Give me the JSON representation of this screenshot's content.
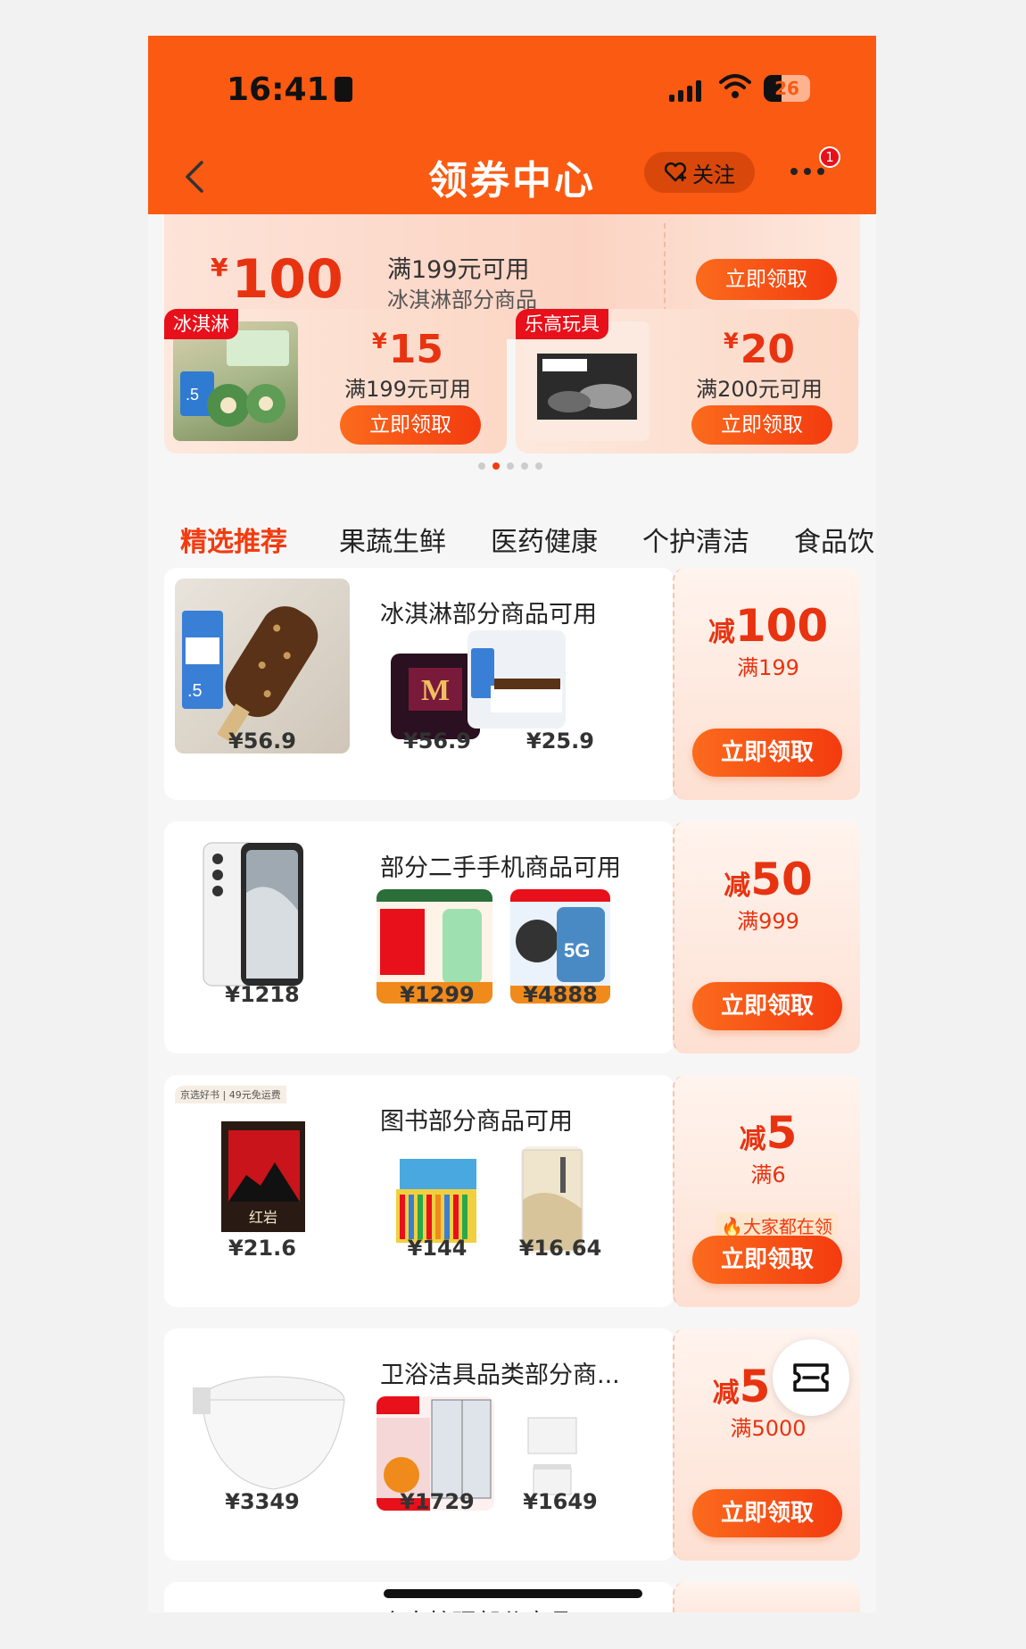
{
  "status_bar": {
    "time": "16:41",
    "battery": "26"
  },
  "header": {
    "title": "领券中心",
    "follow_label": "关注",
    "notification_count": "1"
  },
  "top_coupon": {
    "currency": "¥",
    "amount": "100",
    "condition": "满199元可用",
    "scope": "冰淇淋部分商品",
    "button": "立即领取"
  },
  "mini_coupons": [
    {
      "tag": "冰淇淋",
      "currency": "¥",
      "amount": "15",
      "condition": "满199元可用",
      "button": "立即领取"
    },
    {
      "tag": "乐高玩具",
      "currency": "¥",
      "amount": "20",
      "condition": "满200元可用",
      "button": "立即领取"
    }
  ],
  "tabs": [
    "精选推荐",
    "果蔬生鲜",
    "医药健康",
    "个护清洁",
    "食品饮"
  ],
  "cards": [
    {
      "title": "冰淇淋部分商品可用",
      "prices": [
        "¥56.9",
        "¥56.9",
        "¥25.9"
      ],
      "off_prefix": "减",
      "off": "100",
      "condition": "满199",
      "button": "立即领取"
    },
    {
      "title": "部分二手手机商品可用",
      "prices": [
        "¥1218",
        "¥1299",
        "¥4888"
      ],
      "off_prefix": "减",
      "off": "50",
      "condition": "满999",
      "button": "立即领取"
    },
    {
      "title": "图书部分商品可用",
      "prices": [
        "¥21.6",
        "¥144",
        "¥16.64"
      ],
      "off_prefix": "减",
      "off": "5",
      "condition": "满6",
      "hot": "大家都在领",
      "button": "立即领取",
      "badge": "京选好书 | 49元免运费",
      "book_title": "红岩"
    },
    {
      "title": "卫浴洁具品类部分商...",
      "prices": [
        "¥3349",
        "¥1729",
        "¥1649"
      ],
      "off_prefix": "减",
      "off": "5",
      "condition": "满5000",
      "button": "立即领取"
    }
  ],
  "next_card_title": "个人护理部分商品可用",
  "colors": {
    "brand": "#fa5a12",
    "accent": "#f33b0f"
  }
}
